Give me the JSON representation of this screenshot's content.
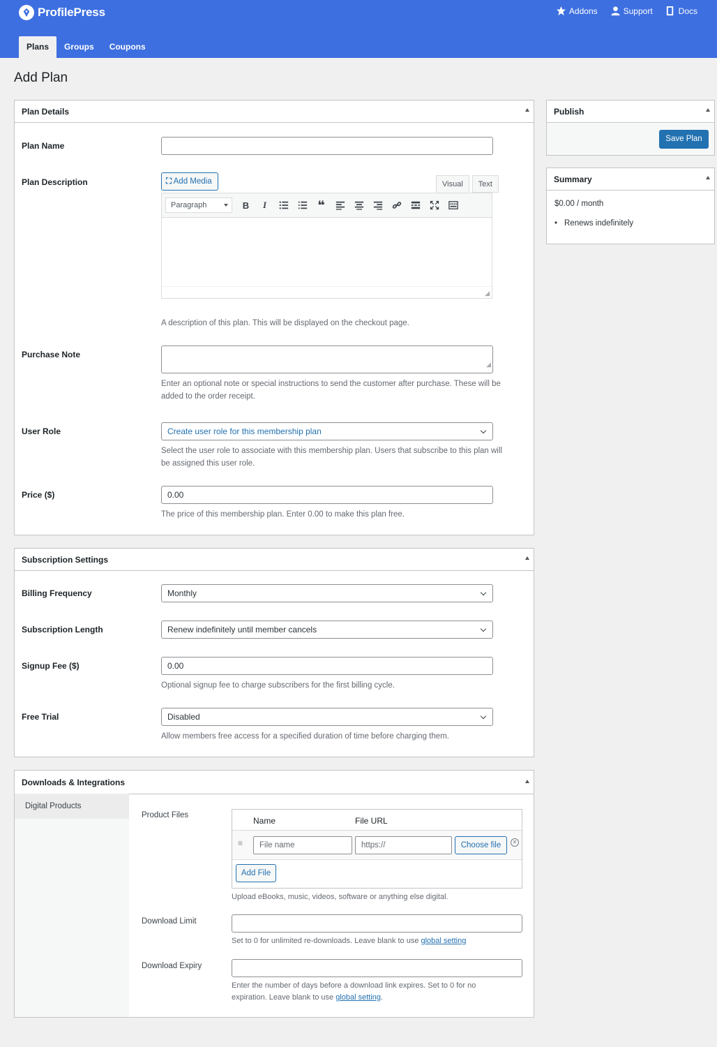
{
  "header": {
    "brand": "ProfilePress",
    "links": [
      {
        "label": "Addons",
        "icon": "star-icon"
      },
      {
        "label": "Support",
        "icon": "user-icon"
      },
      {
        "label": "Docs",
        "icon": "book-icon"
      }
    ],
    "tabs": [
      {
        "label": "Plans",
        "active": true
      },
      {
        "label": "Groups",
        "active": false
      },
      {
        "label": "Coupons",
        "active": false
      }
    ]
  },
  "page_title": "Add Plan",
  "plan_details": {
    "title": "Plan Details",
    "plan_name_label": "Plan Name",
    "plan_name_value": "",
    "plan_description_label": "Plan Description",
    "add_media": "Add Media",
    "editor_tabs": [
      "Visual",
      "Text"
    ],
    "format_select": "Paragraph",
    "description_help": "A description of this plan. This will be displayed on the checkout page.",
    "purchase_note_label": "Purchase Note",
    "purchase_note_help": "Enter an optional note or special instructions to send the customer after purchase. These will be added to the order receipt.",
    "user_role_label": "User Role",
    "user_role_value": "Create user role for this membership plan",
    "user_role_help": "Select the user role to associate with this membership plan. Users that subscribe to this plan will be assigned this user role.",
    "price_label": "Price ($)",
    "price_value": "0.00",
    "price_help": "The price of this membership plan. Enter 0.00 to make this plan free."
  },
  "subscription": {
    "title": "Subscription Settings",
    "billing_label": "Billing Frequency",
    "billing_value": "Monthly",
    "length_label": "Subscription Length",
    "length_value": "Renew indefinitely until member cancels",
    "signup_label": "Signup Fee ($)",
    "signup_value": "0.00",
    "signup_help": "Optional signup fee to charge subscribers for the first billing cycle.",
    "trial_label": "Free Trial",
    "trial_value": "Disabled",
    "trial_help": "Allow members free access for a specified duration of time before charging them."
  },
  "downloads": {
    "title": "Downloads & Integrations",
    "side_tab": "Digital Products",
    "product_files_label": "Product Files",
    "col_name": "Name",
    "col_url": "File URL",
    "file_name_placeholder": "File name",
    "file_url_placeholder": "https://",
    "choose_file": "Choose file",
    "add_file": "Add File",
    "files_help": "Upload eBooks, music, videos, software or anything else digital.",
    "limit_label": "Download Limit",
    "limit_help_prefix": "Set to 0 for unlimited re-downloads. Leave blank to use ",
    "global_setting": "global setting",
    "expiry_label": "Download Expiry",
    "expiry_help_prefix": "Enter the number of days before a download link expires. Set to 0 for no expiration. Leave blank to use ",
    "period": "."
  },
  "publish": {
    "title": "Publish",
    "save": "Save Plan"
  },
  "summary": {
    "title": "Summary",
    "price_line": "$0.00 / month",
    "renew_line": "Renews indefinitely"
  },
  "colors": {
    "brand": "#3d6fe0",
    "primary_button": "#2271b1"
  }
}
